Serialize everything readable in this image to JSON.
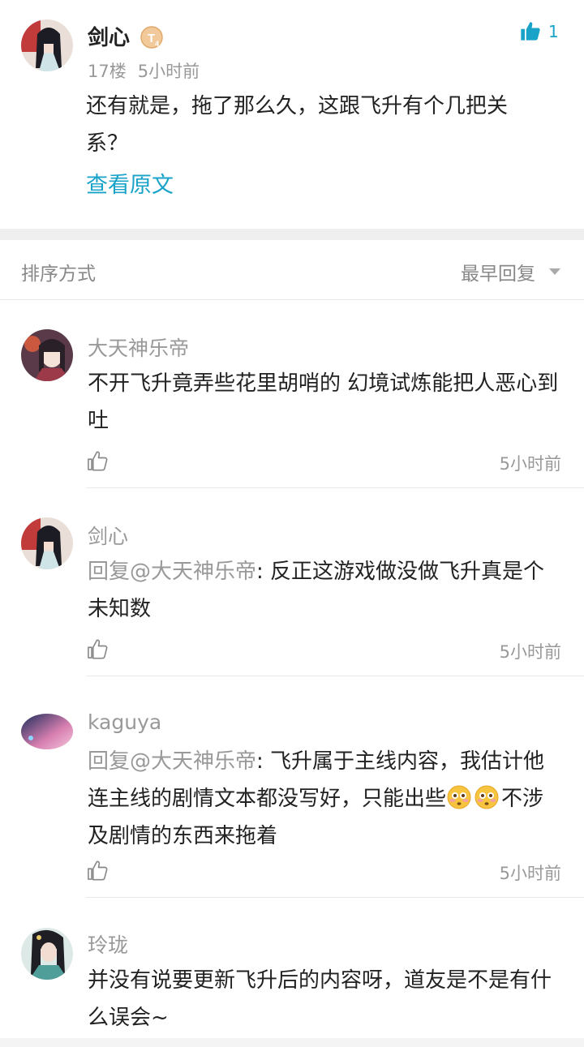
{
  "post": {
    "author": "剑心",
    "level_badge": "T4",
    "floor": "17楼",
    "time": "5小时前",
    "text": "还有就是，拖了那么久，这跟飞升有个几把关系？",
    "view_original": "查看原文",
    "like_count": "1"
  },
  "sort": {
    "label": "排序方式",
    "value": "最早回复"
  },
  "replies": [
    {
      "name": "大天神乐帝",
      "mention": "",
      "text": "不开飞升竟弄些花里胡哨的 幻境试炼能把人恶心到吐",
      "time": "5小时前"
    },
    {
      "name": "剑心",
      "mention": "回复@大天神乐帝",
      "text": ": 反正这游戏做没做飞升真是个未知数",
      "time": "5小时前"
    },
    {
      "name": "kaguya",
      "mention": "回复@大天神乐帝",
      "text": ": 飞升属于主线内容，我估计他连主线的剧情文本都没写好，只能出些",
      "text_after": "不涉及剧情的东西来拖着",
      "time": "5小时前"
    },
    {
      "name": "玲珑",
      "mention": "",
      "text": "并没有说要更新飞升后的内容呀，道友是不是有什么误会~"
    }
  ],
  "colors": {
    "accent": "#1aa3c8",
    "meta": "#999999",
    "separator": "#efefef"
  },
  "icons": [
    "thumbs-up-icon",
    "level-badge-icon",
    "dropdown-arrow-icon",
    "flushed-face-emoji"
  ]
}
